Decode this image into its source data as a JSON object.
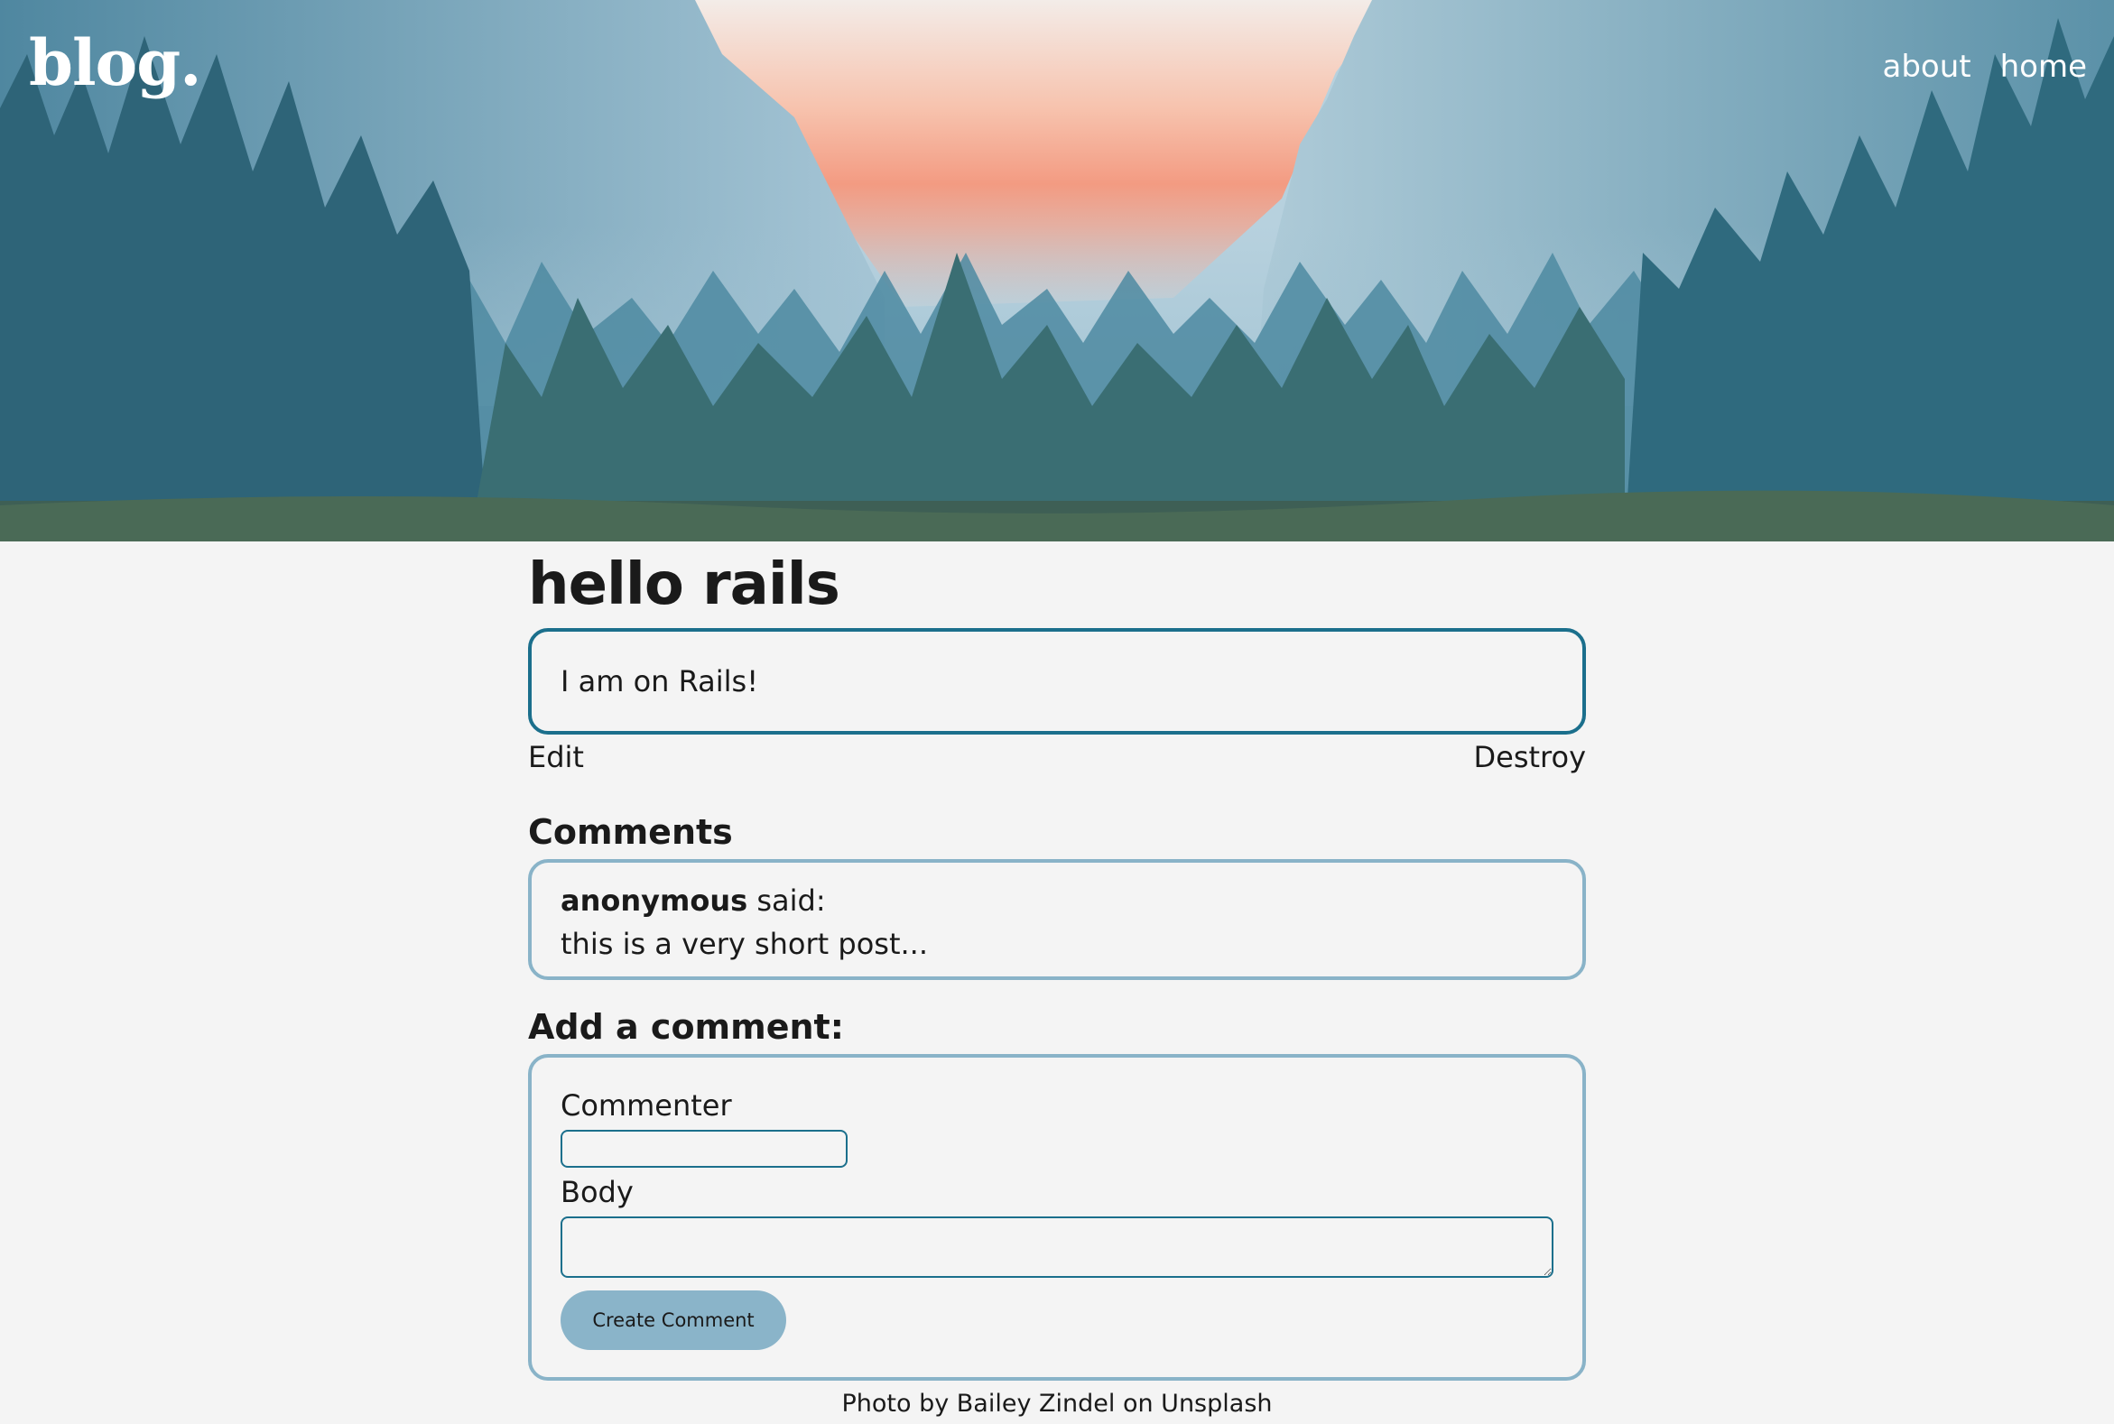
{
  "header": {
    "logo": "blog.",
    "nav": [
      {
        "label": "about"
      },
      {
        "label": "home"
      }
    ]
  },
  "post": {
    "title": "hello rails",
    "body": "I am on Rails!",
    "edit_label": "Edit",
    "destroy_label": "Destroy"
  },
  "comments": {
    "heading": "Comments",
    "items": [
      {
        "author": "anonymous",
        "said": "said:",
        "text": "this is a very short post..."
      }
    ]
  },
  "form": {
    "heading": "Add a comment:",
    "commenter_label": "Commenter",
    "commenter_value": "",
    "body_label": "Body",
    "body_value": "",
    "submit_label": "Create Comment"
  },
  "footer": {
    "credit": "Photo by Bailey Zindel on Unsplash"
  },
  "colors": {
    "accent": "#1b6f8c",
    "border_light": "#89b3c8",
    "button": "#8ab4c9",
    "background": "#f4f4f4"
  }
}
